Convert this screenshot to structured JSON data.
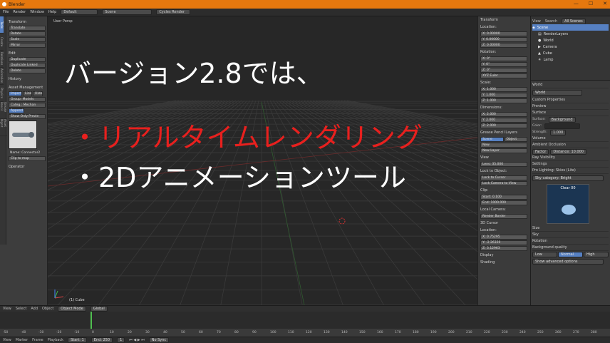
{
  "window": {
    "title": "Blender"
  },
  "menubar": {
    "items": [
      "File",
      "Render",
      "Window",
      "Help"
    ],
    "screen": "Default",
    "scene": "Scene",
    "engine": "Cycles Render"
  },
  "left_panel": {
    "tabs": [
      "Tools",
      "Create",
      "Relations",
      "Animation",
      "Physics",
      "Grease Pencil",
      "Asset Mgmt"
    ],
    "transform": {
      "title": "Transform",
      "buttons": [
        "Translate",
        "Rotate",
        "Scale",
        "Mirror"
      ]
    },
    "edit": {
      "title": "Edit",
      "buttons": [
        "Duplicate",
        "Duplicate Linked",
        "Delete"
      ]
    },
    "history": {
      "title": "History"
    },
    "asset": {
      "title": "Asset Management",
      "modes": [
        "Import",
        "Link",
        "Hide"
      ],
      "rows": [
        "Group: Models",
        "Categ.: Mechan"
      ],
      "toggle": "Append",
      "show_only": "Show Only Previe",
      "name": "Name: Connector2",
      "clip": "Clip to map"
    },
    "operator": "Operator"
  },
  "viewport": {
    "label": "User Persp",
    "object": "(1) Cube"
  },
  "overlay": {
    "heading": "バージョン2.8では、",
    "bullet1": "・リアルタイムレンダリング",
    "bullet2": "・2Dアニメーションツール"
  },
  "n_panel": {
    "transform": "Transform",
    "location": "Location:",
    "loc": [
      "X: 0.00000",
      "Y: 0.00000",
      "Z: 0.00000"
    ],
    "rotation": "Rotation:",
    "rot": [
      "X: 0°",
      "Y: 0°",
      "Z: 0°"
    ],
    "rotmode": "XYZ Euler",
    "scale": "Scale:",
    "scl": [
      "X: 1.000",
      "Y: 1.000",
      "Z: 1.000"
    ],
    "dimensions": "Dimensions:",
    "dim": [
      "X: 2.000",
      "Y: 2.000",
      "Z: 2.000"
    ],
    "gp": "Grease Pencil Layers",
    "gp_tabs": [
      "Scene",
      "Object"
    ],
    "gp_new": "New",
    "gp_newlayer": "New Layer",
    "view": "View",
    "lens": "Lens: 35.000",
    "lock": "Lock to Object:",
    "lock_cursor": "Lock to Cursor",
    "lock_camera": "Lock Camera to View",
    "clip": "Clip:",
    "clip_start": "Start: 0.100",
    "clip_end": "End: 1000.000",
    "local_camera": "Local Camera:",
    "render_border": "Render Border",
    "cursor": "3D Cursor",
    "cursor_location": "Location:",
    "cursor_loc": [
      "X: 0.75295",
      "Y: -2.26320",
      "Z: 3.12963"
    ],
    "display": "Display",
    "shading": "Shading"
  },
  "outliner": {
    "menu": [
      "View",
      "Search",
      "All Scenes"
    ],
    "items": [
      "Scene",
      "RenderLayers",
      "World",
      "Camera",
      "Cube",
      "Lamp"
    ]
  },
  "properties": {
    "context": "World",
    "world_field": "World",
    "sections": [
      "Custom Properties",
      "Preview",
      "Surface",
      "Volume",
      "Ambient Occlusion",
      "Ray Visibility",
      "Settings"
    ],
    "surface": "Surface:",
    "surface_val": "Background",
    "color": "Color:",
    "strength": "Strength:",
    "strength_val": "1.000",
    "ao_factor": "Factor",
    "ao_distance": "Distance: 10.000",
    "pro_lighting": "Pro Lighting: Skies (Lite)",
    "sky_category": "Sky category: Bright",
    "sky_preset": "Clear 00",
    "sky_size": "Size",
    "sky_sky": "Sky",
    "sky_rotation": "Rotation",
    "bg_quality": "Background quality",
    "bg_quality_opts": [
      "Low",
      "Normal",
      "High"
    ],
    "show_options": "Show advanced options"
  },
  "header3d": {
    "items": [
      "View",
      "Select",
      "Add",
      "Object"
    ],
    "mode": "Object Mode",
    "pivot": "Global"
  },
  "timeline": {
    "ruler": [
      "-50",
      "-40",
      "-30",
      "-20",
      "-10",
      "0",
      "10",
      "20",
      "30",
      "40",
      "50",
      "60",
      "70",
      "80",
      "90",
      "100",
      "110",
      "120",
      "130",
      "140",
      "150",
      "160",
      "170",
      "180",
      "190",
      "200",
      "210",
      "220",
      "230",
      "240",
      "250",
      "260",
      "270",
      "280"
    ],
    "bar": [
      "View",
      "Marker",
      "Frame",
      "Playback"
    ],
    "start": "Start: 1",
    "end": "End: 250",
    "current": "1",
    "sync": "No Sync"
  }
}
